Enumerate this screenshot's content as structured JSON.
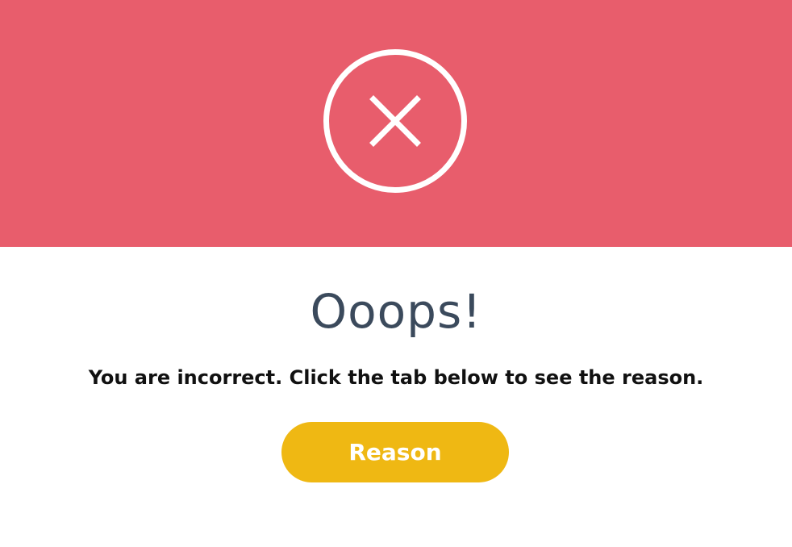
{
  "header": {
    "background_color": "#e85d6c",
    "icon": "close-icon"
  },
  "content": {
    "title": "Ooops!",
    "message": "You are incorrect. Click the tab below to see the reason.",
    "reason_button_label": "Reason",
    "button_color": "#efb813"
  }
}
